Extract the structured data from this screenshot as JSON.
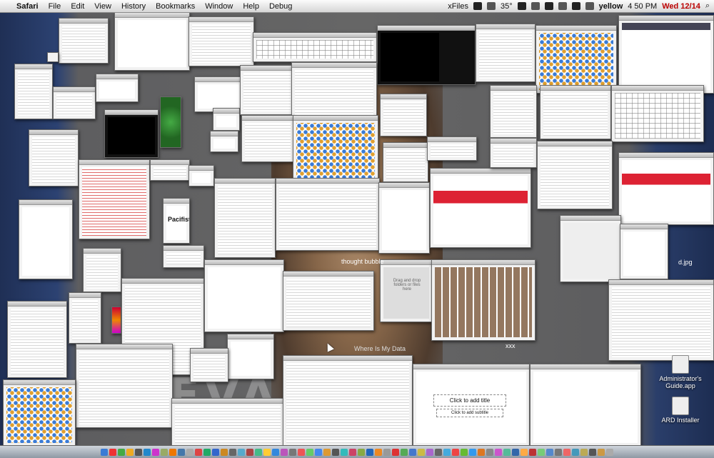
{
  "menubar": {
    "apple_glyph": "",
    "app_name": "Safari",
    "items": [
      "File",
      "Edit",
      "View",
      "History",
      "Bookmarks",
      "Window",
      "Help",
      "Debug"
    ],
    "right": {
      "xfiles_label": "xFiles",
      "temperature": "35°",
      "user_name": "yellow",
      "time": "4 50 PM",
      "date": "Wed 12/14"
    }
  },
  "desktop": {
    "background_text": "EVA",
    "icons": [
      {
        "name": "Administrator's Guide.app"
      },
      {
        "name": "ARD Installer"
      }
    ],
    "labels": {
      "cut_label_1": "thought bubble",
      "cut_label_2": "Where Is My Data",
      "cut_label_3": "d.jpg",
      "cut_label_4": "xxx"
    }
  },
  "windows": {
    "ppt_title": "Click to add title",
    "ppt_subtitle": "Click to add subtitle",
    "pacifist_title": "Pacifist",
    "drop_message": "Drag and drop folders or files here"
  },
  "colors": {
    "menubar": "#e8e8e8",
    "desktop": "#666666",
    "date_red": "#bb0000"
  }
}
